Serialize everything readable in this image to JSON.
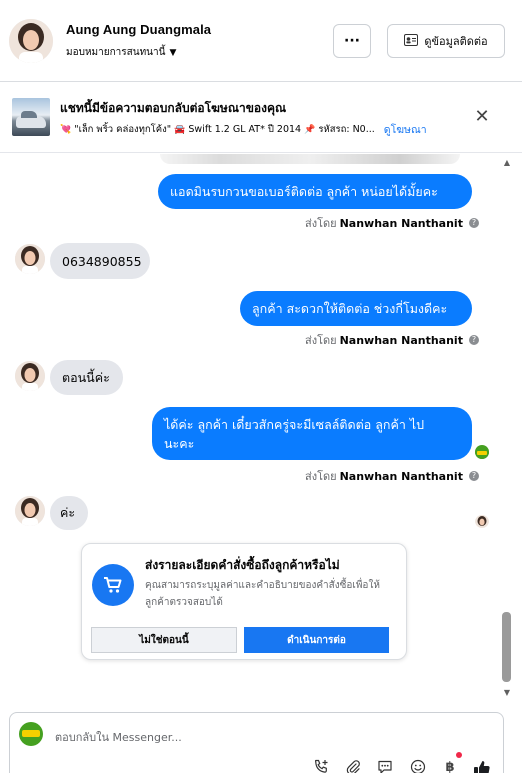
{
  "header": {
    "contact_name": "Aung Aung Duangmala",
    "assign_label": "มอบหมายการสนทนานี้",
    "more_label": "···",
    "contact_info_label": "ดูข้อมูลติดต่อ"
  },
  "ad_banner": {
    "title": "แชทนี้มีข้อความตอบกลับต่อโฆษณาของคุณ",
    "subtitle_quote": "\"เล็ก พริ้ว คล่องทุกโค้ง\"",
    "subtitle_car": "Swift 1.2 GL AT* ปี 2014",
    "subtitle_code": "รหัสรถ: N0...",
    "view_ad_label": "ดูโฆษณา"
  },
  "messages": [
    {
      "direction": "out",
      "text": "แอดมินรบกวนขอเบอร์ติดต่อ ลูกค้า  หน่อยได้มั้ยคะ"
    },
    {
      "direction": "in",
      "text": "0634890855"
    },
    {
      "direction": "out",
      "text": "ลูกค้า สะดวกให้ติดต่อ ช่วงกี่โมงดีคะ"
    },
    {
      "direction": "in",
      "text": "ตอนนี้ค่ะ"
    },
    {
      "direction": "out",
      "text_line1": "ได้ค่ะ  ลูกค้า  เดี๋ยวสักครู่จะมีเซลล์ติดต่อ ลูกค้า ไป",
      "text_line2": "นะคะ"
    },
    {
      "direction": "in",
      "text": "ค่ะ"
    }
  ],
  "sent_by": {
    "prefix": "ส่งโดย",
    "agent": "Nanwhan Nanthanit"
  },
  "order_card": {
    "title": "ส่งรายละเอียดคำสั่งซื้อถึงลูกค้าหรือไม่",
    "description": "คุณสามารถระบุมูลค่าและคำอธิบายของคำสั่งซื้อเพื่อให้ลูกค้าตรวจสอบได้",
    "decline_label": "ไม่ใช่ตอนนี้",
    "proceed_label": "ดำเนินการต่อ"
  },
  "composer": {
    "placeholder": "ตอบกลับใน Messenger..."
  },
  "colors": {
    "outgoing_bubble": "#0a7cff",
    "incoming_bubble": "#e4e6eb",
    "accent": "#1877f2"
  }
}
